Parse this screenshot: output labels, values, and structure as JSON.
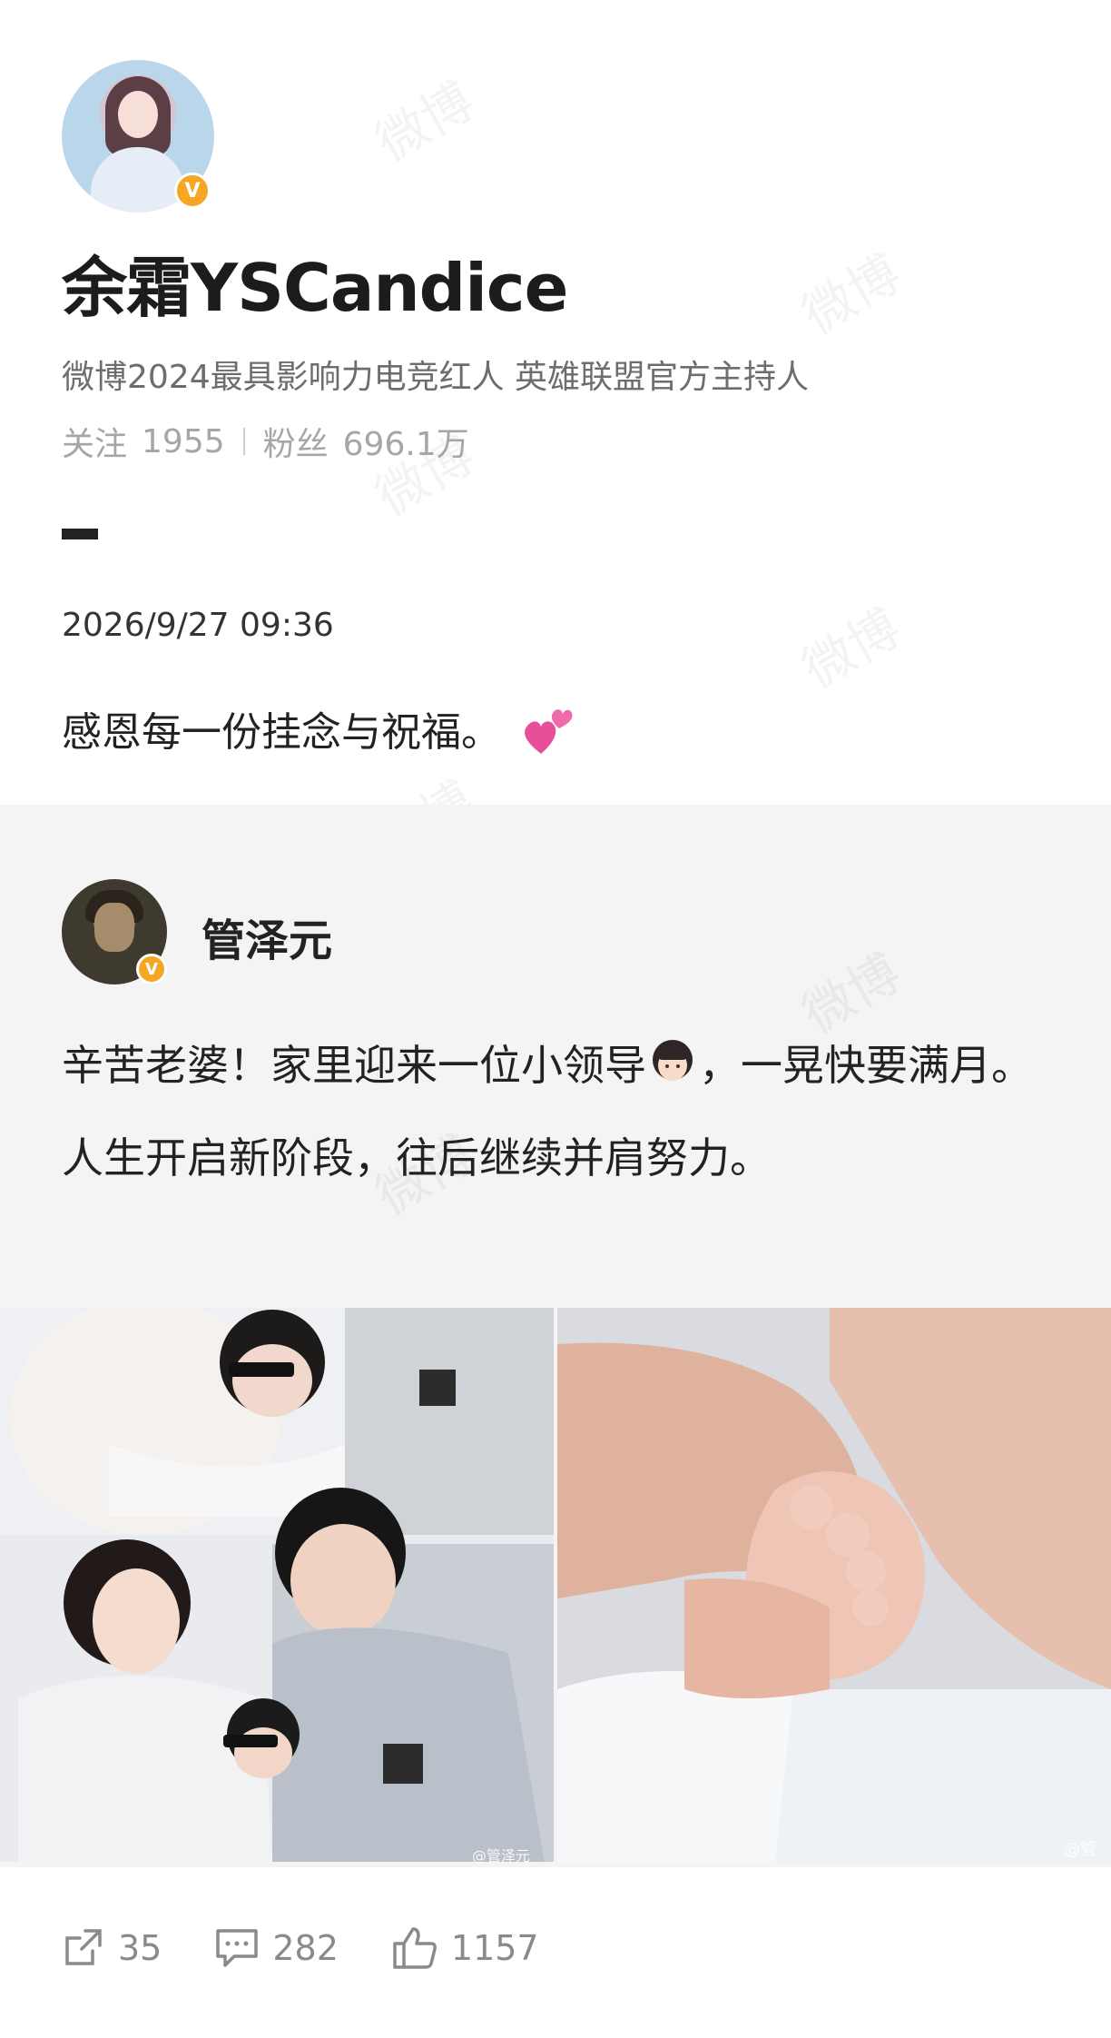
{
  "profile": {
    "name": "余霜YSCandice",
    "description": "微博2024最具影响力电竞红人 英雄联盟官方主持人",
    "following_label": "关注",
    "following_count": "1955",
    "followers_label": "粉丝",
    "followers_count": "696.1万",
    "verified_badge": "V"
  },
  "post": {
    "time": "2026/9/27 09:36",
    "text": "感恩每一份挂念与祝福。",
    "emoji_icon": "two-hearts-icon"
  },
  "repost": {
    "author": "管泽元",
    "verified_badge": "V",
    "text_line1": "辛苦老婆！家里迎来一位小领导",
    "text_line1_end": "，一晃快要满月。",
    "text_line2": "人生开启新阶段，往后继续并肩努力。",
    "images": [
      {
        "name": "family-photo",
        "watermark": "@管泽元"
      },
      {
        "name": "baby-hand-photo",
        "watermark": "@管"
      }
    ]
  },
  "actions": {
    "share_count": "35",
    "comment_count": "282",
    "like_count": "1157"
  },
  "watermark_text": "微博",
  "colors": {
    "verified": "#f5a623",
    "muted": "#a6a6a6",
    "repost_bg": "#f4f4f4"
  }
}
